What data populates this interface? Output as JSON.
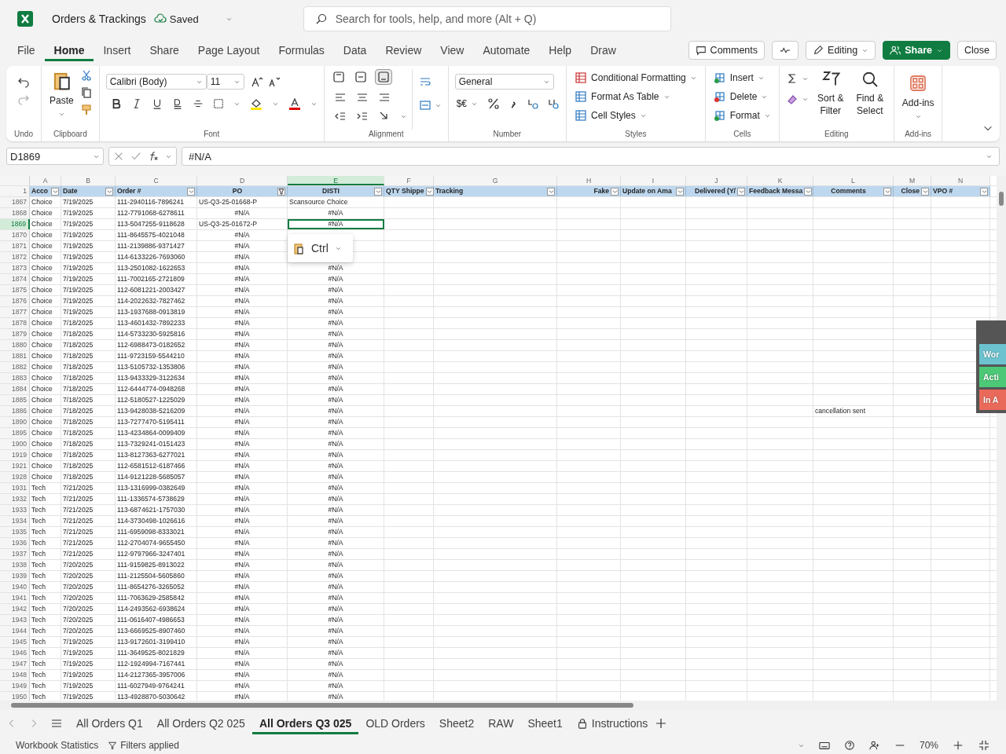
{
  "app": {
    "title": "Orders & Trackings",
    "save_status": "Saved",
    "search_placeholder": "Search for tools, help, and more (Alt + Q)"
  },
  "menu": [
    {
      "label": "File",
      "selected": false
    },
    {
      "label": "Home",
      "selected": true
    },
    {
      "label": "Insert",
      "selected": false
    },
    {
      "label": "Share",
      "selected": false
    },
    {
      "label": "Page Layout",
      "selected": false
    },
    {
      "label": "Formulas",
      "selected": false
    },
    {
      "label": "Data",
      "selected": false
    },
    {
      "label": "Review",
      "selected": false
    },
    {
      "label": "View",
      "selected": false
    },
    {
      "label": "Automate",
      "selected": false
    },
    {
      "label": "Help",
      "selected": false
    },
    {
      "label": "Draw",
      "selected": false
    }
  ],
  "actions": [
    {
      "kind": "comments",
      "label": "Comments"
    },
    {
      "kind": "activity"
    },
    {
      "kind": "editing",
      "label": "Editing"
    },
    {
      "kind": "share",
      "label": "Share"
    },
    {
      "kind": "close",
      "label": "Close"
    }
  ],
  "ribbon": [
    {
      "kind": "undo",
      "label": "Undo"
    },
    {
      "kind": "clipboard",
      "label": "Clipboard",
      "paste": "Paste"
    },
    {
      "kind": "font",
      "label": "Font",
      "font_name": "Calibri (Body)",
      "font_size": "11"
    },
    {
      "kind": "alignment",
      "label": "Alignment",
      "vertical": [
        {
          "selected": false
        },
        {
          "selected": false
        },
        {
          "selected": true
        }
      ]
    },
    {
      "kind": "number",
      "label": "Number",
      "format": "General",
      "currency": "$€"
    },
    {
      "kind": "styles",
      "label": "Styles",
      "items": [
        "Conditional Formatting",
        "Format As Table",
        "Cell Styles"
      ]
    },
    {
      "kind": "cells",
      "label": "Cells",
      "items": [
        "Insert",
        "Delete",
        "Format"
      ]
    },
    {
      "kind": "editing",
      "label": "Editing",
      "items": [
        "Sort & Filter",
        "Find & Select"
      ]
    },
    {
      "kind": "addins",
      "label": "Add-ins",
      "button": "Add-ins"
    }
  ],
  "formula_bar": {
    "name_box": "D1869",
    "formula": "#N/A"
  },
  "sheet": {
    "corner_row": "1",
    "columns": [
      {
        "letter": "A",
        "header": "Acco",
        "filtered": false,
        "selected": false
      },
      {
        "letter": "B",
        "header": "Date",
        "filtered": false,
        "selected": false
      },
      {
        "letter": "C",
        "header": "Order #",
        "filtered": false,
        "selected": false
      },
      {
        "letter": "D",
        "header": "PO",
        "filtered": true,
        "selected": false
      },
      {
        "letter": "E",
        "header": "DISTI",
        "filtered": false,
        "selected": true
      },
      {
        "letter": "F",
        "header": "QTY Shippe",
        "filtered": false,
        "selected": false
      },
      {
        "letter": "G",
        "header": "Tracking",
        "filtered": false,
        "selected": false
      },
      {
        "letter": "H",
        "header": "Fake",
        "filtered": false,
        "selected": false
      },
      {
        "letter": "I",
        "header": "Update on Ama",
        "filtered": false,
        "selected": false
      },
      {
        "letter": "J",
        "header": "Delivered (Y/",
        "filtered": false,
        "selected": false
      },
      {
        "letter": "K",
        "header": "Feedback Messa",
        "filtered": false,
        "selected": false
      },
      {
        "letter": "L",
        "header": "Comments",
        "filtered": false,
        "selected": false
      },
      {
        "letter": "M",
        "header": "Close",
        "filtered": false,
        "selected": false
      },
      {
        "letter": "N",
        "header": "VPO #",
        "filtered": false,
        "selected": false
      }
    ],
    "rows": [
      {
        "n": "1867",
        "account": "Choice",
        "date": "7/19/2025",
        "order": "111-2940116-7896241",
        "po": "US-Q3-25-01668-P",
        "disti": "Scansource Choice",
        "selected": false
      },
      {
        "n": "1868",
        "account": "Choice",
        "date": "7/19/2025",
        "order": "112-7791068-6278611",
        "po": "#N/A",
        "disti": "#N/A",
        "selected": false
      },
      {
        "n": "1869",
        "account": "Choice",
        "date": "7/19/2025",
        "order": "113-5047255-9118628",
        "po": "US-Q3-25-01672-P",
        "disti": "#N/A",
        "selected": true
      },
      {
        "n": "1870",
        "account": "Choice",
        "date": "7/19/2025",
        "order": "111-8645575-4021048",
        "po": "#N/A",
        "selected": false
      },
      {
        "n": "1871",
        "account": "Choice",
        "date": "7/19/2025",
        "order": "111-2139886-9371427",
        "po": "#N/A",
        "selected": false
      },
      {
        "n": "1872",
        "account": "Choice",
        "date": "7/19/2025",
        "order": "114-6133226-7693060",
        "po": "#N/A",
        "selected": false
      },
      {
        "n": "1873",
        "account": "Choice",
        "date": "7/19/2025",
        "order": "113-2501082-1622653",
        "po": "#N/A",
        "disti": "#N/A",
        "selected": false
      },
      {
        "n": "1874",
        "account": "Choice",
        "date": "7/19/2025",
        "order": "111-7002165-2721809",
        "po": "#N/A",
        "disti": "#N/A",
        "selected": false
      },
      {
        "n": "1875",
        "account": "Choice",
        "date": "7/19/2025",
        "order": "112-6081221-2003427",
        "po": "#N/A",
        "disti": "#N/A",
        "selected": false
      },
      {
        "n": "1876",
        "account": "Choice",
        "date": "7/19/2025",
        "order": "114-2022632-7827462",
        "po": "#N/A",
        "disti": "#N/A",
        "selected": false
      },
      {
        "n": "1877",
        "account": "Choice",
        "date": "7/19/2025",
        "order": "113-1937688-0913819",
        "po": "#N/A",
        "disti": "#N/A",
        "selected": false
      },
      {
        "n": "1878",
        "account": "Choice",
        "date": "7/18/2025",
        "order": "113-4601432-7892233",
        "po": "#N/A",
        "disti": "#N/A",
        "selected": false
      },
      {
        "n": "1879",
        "account": "Choice",
        "date": "7/18/2025",
        "order": "114-5733230-5925816",
        "po": "#N/A",
        "disti": "#N/A",
        "selected": false
      },
      {
        "n": "1880",
        "account": "Choice",
        "date": "7/18/2025",
        "order": "112-6988473-0182652",
        "po": "#N/A",
        "disti": "#N/A",
        "selected": false
      },
      {
        "n": "1881",
        "account": "Choice",
        "date": "7/18/2025",
        "order": "111-9723159-5544210",
        "po": "#N/A",
        "disti": "#N/A",
        "selected": false
      },
      {
        "n": "1882",
        "account": "Choice",
        "date": "7/18/2025",
        "order": "113-5105732-1353806",
        "po": "#N/A",
        "disti": "#N/A",
        "selected": false
      },
      {
        "n": "1883",
        "account": "Choice",
        "date": "7/18/2025",
        "order": "113-9433329-3122634",
        "po": "#N/A",
        "disti": "#N/A",
        "selected": false
      },
      {
        "n": "1884",
        "account": "Choice",
        "date": "7/18/2025",
        "order": "112-6444774-0948268",
        "po": "#N/A",
        "disti": "#N/A",
        "selected": false
      },
      {
        "n": "1885",
        "account": "Choice",
        "date": "7/18/2025",
        "order": "112-5180527-1225029",
        "po": "#N/A",
        "disti": "#N/A",
        "selected": false
      },
      {
        "n": "1886",
        "account": "Choice",
        "date": "7/18/2025",
        "order": "113-9428038-5216209",
        "po": "#N/A",
        "disti": "#N/A",
        "comments": "cancellation sent",
        "selected": false
      },
      {
        "n": "1890",
        "account": "Choice",
        "date": "7/18/2025",
        "order": "113-7277470-5195411",
        "po": "#N/A",
        "disti": "#N/A",
        "selected": false
      },
      {
        "n": "1895",
        "account": "Choice",
        "date": "7/18/2025",
        "order": "113-4234864-0099409",
        "po": "#N/A",
        "disti": "#N/A",
        "selected": false
      },
      {
        "n": "1900",
        "account": "Choice",
        "date": "7/18/2025",
        "order": "113-7329241-0151423",
        "po": "#N/A",
        "disti": "#N/A",
        "selected": false
      },
      {
        "n": "1919",
        "account": "Choice",
        "date": "7/18/2025",
        "order": "113-8127363-6277021",
        "po": "#N/A",
        "disti": "#N/A",
        "selected": false
      },
      {
        "n": "1921",
        "account": "Choice",
        "date": "7/18/2025",
        "order": "112-6581512-6187466",
        "po": "#N/A",
        "disti": "#N/A",
        "selected": false
      },
      {
        "n": "1928",
        "account": "Choice",
        "date": "7/18/2025",
        "order": "114-9121228-5685057",
        "po": "#N/A",
        "disti": "#N/A",
        "selected": false
      },
      {
        "n": "1931",
        "account": "Tech",
        "date": "7/21/2025",
        "order": "113-1316999-0382649",
        "po": "#N/A",
        "disti": "#N/A",
        "selected": false
      },
      {
        "n": "1932",
        "account": "Tech",
        "date": "7/21/2025",
        "order": "111-1336574-5738629",
        "po": "#N/A",
        "disti": "#N/A",
        "selected": false
      },
      {
        "n": "1933",
        "account": "Tech",
        "date": "7/21/2025",
        "order": "113-6874621-1757030",
        "po": "#N/A",
        "disti": "#N/A",
        "selected": false
      },
      {
        "n": "1934",
        "account": "Tech",
        "date": "7/21/2025",
        "order": "114-3730498-1026616",
        "po": "#N/A",
        "disti": "#N/A",
        "selected": false
      },
      {
        "n": "1935",
        "account": "Tech",
        "date": "7/21/2025",
        "order": "111-6959098-8333021",
        "po": "#N/A",
        "disti": "#N/A",
        "selected": false
      },
      {
        "n": "1936",
        "account": "Tech",
        "date": "7/21/2025",
        "order": "112-2704074-9655450",
        "po": "#N/A",
        "disti": "#N/A",
        "selected": false
      },
      {
        "n": "1937",
        "account": "Tech",
        "date": "7/21/2025",
        "order": "112-9797966-3247401",
        "po": "#N/A",
        "disti": "#N/A",
        "selected": false
      },
      {
        "n": "1938",
        "account": "Tech",
        "date": "7/20/2025",
        "order": "111-9159825-8913022",
        "po": "#N/A",
        "disti": "#N/A",
        "selected": false
      },
      {
        "n": "1939",
        "account": "Tech",
        "date": "7/20/2025",
        "order": "111-2125504-5605860",
        "po": "#N/A",
        "disti": "#N/A",
        "selected": false
      },
      {
        "n": "1940",
        "account": "Tech",
        "date": "7/20/2025",
        "order": "111-8654276-3265052",
        "po": "#N/A",
        "disti": "#N/A",
        "selected": false
      },
      {
        "n": "1941",
        "account": "Tech",
        "date": "7/20/2025",
        "order": "111-7063629-2585842",
        "po": "#N/A",
        "disti": "#N/A",
        "selected": false
      },
      {
        "n": "1942",
        "account": "Tech",
        "date": "7/20/2025",
        "order": "114-2493562-6938624",
        "po": "#N/A",
        "disti": "#N/A",
        "selected": false
      },
      {
        "n": "1943",
        "account": "Tech",
        "date": "7/20/2025",
        "order": "111-0616407-4986653",
        "po": "#N/A",
        "disti": "#N/A",
        "selected": false
      },
      {
        "n": "1944",
        "account": "Tech",
        "date": "7/20/2025",
        "order": "113-6669525-8907460",
        "po": "#N/A",
        "disti": "#N/A",
        "selected": false
      },
      {
        "n": "1945",
        "account": "Tech",
        "date": "7/19/2025",
        "order": "113-9172601-3199410",
        "po": "#N/A",
        "disti": "#N/A",
        "selected": false
      },
      {
        "n": "1946",
        "account": "Tech",
        "date": "7/19/2025",
        "order": "111-3649525-8021829",
        "po": "#N/A",
        "disti": "#N/A",
        "selected": false
      },
      {
        "n": "1947",
        "account": "Tech",
        "date": "7/19/2025",
        "order": "112-1924994-7167441",
        "po": "#N/A",
        "disti": "#N/A",
        "selected": false
      },
      {
        "n": "1948",
        "account": "Tech",
        "date": "7/19/2025",
        "order": "114-2127365-3957006",
        "po": "#N/A",
        "disti": "#N/A",
        "selected": false
      },
      {
        "n": "1949",
        "account": "Tech",
        "date": "7/19/2025",
        "order": "111-6027949-9764241",
        "po": "#N/A",
        "disti": "#N/A",
        "selected": false
      },
      {
        "n": "1950",
        "account": "Tech",
        "date": "7/19/2025",
        "order": "113-4928870-5030642",
        "po": "#N/A",
        "disti": "#N/A",
        "selected": false
      }
    ]
  },
  "paste_popup": {
    "label": "Ctrl"
  },
  "side_panel": {
    "items": [
      {
        "label": "Wor",
        "color": "#6cc3cf"
      },
      {
        "label": "Acti",
        "color": "#4cc877"
      },
      {
        "label": "In A",
        "color": "#e96a5a"
      }
    ]
  },
  "sheet_tabs": [
    {
      "label": "All Orders Q1",
      "kind": "plain",
      "selected": false
    },
    {
      "label": "All Orders Q2 025",
      "kind": "plain",
      "selected": false
    },
    {
      "label": "All Orders Q3 025",
      "kind": "plain",
      "selected": true
    },
    {
      "label": "OLD Orders",
      "kind": "plain",
      "selected": false
    },
    {
      "label": "Sheet2",
      "kind": "plain",
      "selected": false
    },
    {
      "label": "RAW",
      "kind": "plain",
      "selected": false
    },
    {
      "label": "Sheet1",
      "kind": "plain",
      "selected": false
    },
    {
      "label": "Instructions",
      "kind": "locked",
      "selected": false
    }
  ],
  "status_bar": {
    "workbook_statistics": "Workbook Statistics",
    "filters": "Filters applied",
    "zoom": "70%"
  }
}
